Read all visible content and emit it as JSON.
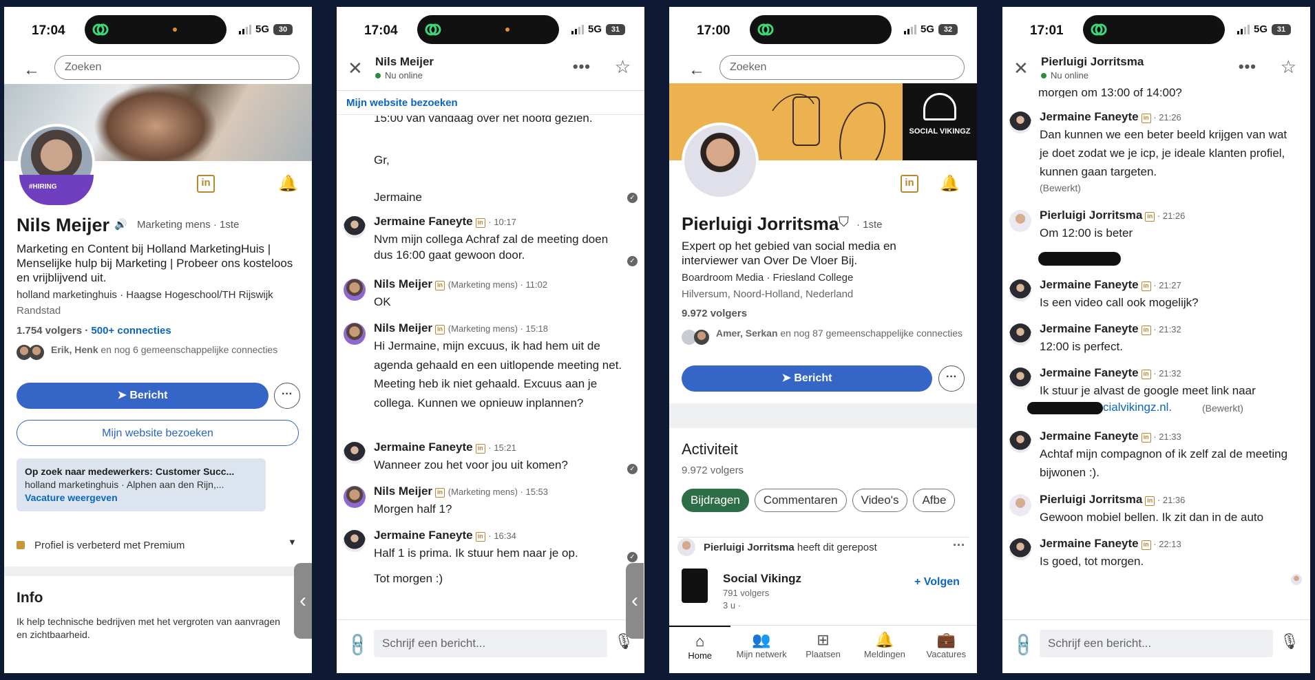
{
  "p1": {
    "time": "17:04",
    "net": "5G",
    "battery": "30",
    "search_placeholder": "Zoeken",
    "hiring": "#HIRING",
    "name": "Nils Meijer",
    "pronoun": "Marketing mens · 1ste",
    "headline": "Marketing en Content bij Holland MarketingHuis | Menselijke hulp bij  Marketing | Probeer ons kosteloos en vrijblijvend uit.",
    "education": "holland marketinghuis · Haagse Hogeschool/TH Rijswijk",
    "location": "Randstad",
    "followers": "1.754 volgers",
    "connections": "500+ connecties",
    "mutual_names": "Erik, Henk",
    "mutual_rest": " en nog 6 gemeenschappelijke connecties",
    "message_label": "Bericht",
    "website_label": "Mijn website bezoeken",
    "job_title": "Op zoek naar medewerkers: Customer Succ...",
    "job_sub": "holland marketinghuis · Alphen aan den Rijn,...",
    "job_link": "Vacature weergeven",
    "premium": "Profiel is verbeterd met Premium",
    "info_title": "Info",
    "info_text": "Ik help technische bedrijven met het vergroten van aanvragen en zichtbaarheid."
  },
  "p2": {
    "time": "17:04",
    "net": "5G",
    "battery": "31",
    "title": "Nils Meijer",
    "status": "Nu online",
    "website_link": "Mijn website bezoeken",
    "cut_line": "15:00 van vandaag over het hoofd gezien.",
    "gr": "Gr,",
    "sign": "Jermaine",
    "messages": [
      {
        "name": "Jermaine Faneyte",
        "sub": "",
        "time": "10:17",
        "text": "Nvm mijn collega Achraf zal de meeting doen dus 16:00 gaat gewoon door."
      },
      {
        "name": "Nils Meijer",
        "sub": "(Marketing mens)",
        "time": "11:02",
        "text": "OK"
      },
      {
        "name": "Nils Meijer",
        "sub": "(Marketing mens)",
        "time": "15:18",
        "text": "Hi Jermaine, mijn excuus, ik had hem uit de agenda gehaald en een uitlopende meeting net. Meeting heb ik niet gehaald. Excuus aan je collega.  Kunnen we opnieuw inplannen?"
      },
      {
        "name": "Jermaine Faneyte",
        "sub": "",
        "time": "15:21",
        "text": "Wanneer zou het voor jou uit komen?"
      },
      {
        "name": "Nils Meijer",
        "sub": "(Marketing mens)",
        "time": "15:53",
        "text": "Morgen half 1?"
      },
      {
        "name": "Jermaine Faneyte",
        "sub": "",
        "time": "16:34",
        "text": "Half 1 is prima. Ik stuur hem naar je op."
      }
    ],
    "last_line": "Tot morgen :)",
    "compose_placeholder": "Schrijf een bericht..."
  },
  "p3": {
    "time": "17:00",
    "net": "5G",
    "battery": "32",
    "search_placeholder": "Zoeken",
    "brand": "SOCIAL VIKINGZ",
    "name": "Pierluigi Jorritsma",
    "degree": "· 1ste",
    "headline": "Expert op het gebied van social media en interviewer van Over De Vloer Bij.",
    "education": "Boardroom Media · Friesland College",
    "location": "Hilversum, Noord-Holland, Nederland",
    "followers": "9.972 volgers",
    "mutual_names": "Amer, Serkan",
    "mutual_rest": " en nog 87 gemeenschappelijke connecties",
    "message_label": "Bericht",
    "activity_title": "Activiteit",
    "activity_followers": "9.972 volgers",
    "tabs": [
      "Bijdragen",
      "Commentaren",
      "Video's",
      "Afbe"
    ],
    "repost_name": "Pierluigi Jorritsma",
    "repost_text": " heeft dit gerepost",
    "company": "Social Vikingz",
    "company_followers": "791 volgers",
    "company_time": "3 u ·",
    "follow_label": "+ Volgen",
    "nav": [
      {
        "icon": "⌂",
        "label": "Home"
      },
      {
        "icon": "👥",
        "label": "Mijn netwerk"
      },
      {
        "icon": "⊞",
        "label": "Plaatsen"
      },
      {
        "icon": "🔔",
        "label": "Meldingen"
      },
      {
        "icon": "💼",
        "label": "Vacatures"
      }
    ]
  },
  "p4": {
    "time": "17:01",
    "net": "5G",
    "battery": "31",
    "title": "Pierluigi Jorritsma",
    "status": "Nu online",
    "top_line": "morgen om 13:00 of 14:00?",
    "messages": [
      {
        "name": "Jermaine Faneyte",
        "time": "21:26",
        "text": "Dan kunnen we een beter beeld krijgen van wat je doet zodat we je icp, je ideale klanten profiel, kunnen gaan targeten.",
        "note": "(Bewerkt)"
      },
      {
        "name": "Pierluigi Jorritsma",
        "time": "21:26",
        "text": "Om 12:00 is beter",
        "note": ""
      },
      {
        "name": "Jermaine Faneyte",
        "time": "21:27",
        "text": "Is een video call ook mogelijk?",
        "note": ""
      },
      {
        "name": "Jermaine Faneyte",
        "time": "21:32",
        "text": "12:00 is perfect.",
        "note": ""
      },
      {
        "name": "Jermaine Faneyte",
        "time": "21:32",
        "text": "Ik stuur je alvast de google meet link naar",
        "note": "(Bewerkt)",
        "link": "cialvikingz.nl."
      },
      {
        "name": "Jermaine Faneyte",
        "time": "21:33",
        "text": "Achtaf mijn compagnon of ik zelf zal de meeting bijwonen :).",
        "note": ""
      },
      {
        "name": "Pierluigi Jorritsma",
        "time": "21:36",
        "text": "Gewoon mobiel bellen. Ik zit dan in de auto",
        "note": ""
      },
      {
        "name": "Jermaine Faneyte",
        "time": "22:13",
        "text": "Is goed, tot morgen.",
        "note": ""
      }
    ],
    "compose_placeholder": "Schrijf een bericht..."
  }
}
